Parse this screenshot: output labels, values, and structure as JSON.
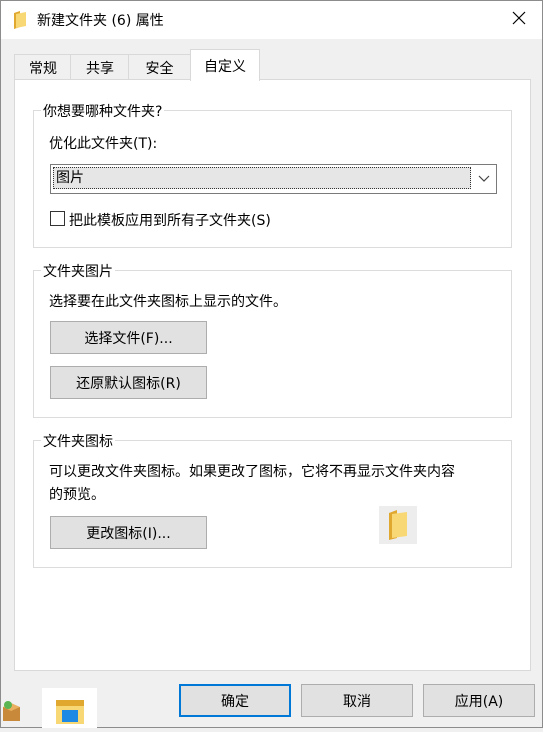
{
  "window": {
    "title": "新建文件夹 (6) 属性"
  },
  "tabs": [
    {
      "label": "常规"
    },
    {
      "label": "共享"
    },
    {
      "label": "安全"
    },
    {
      "label": "自定义"
    }
  ],
  "optimize_group": {
    "title": "你想要哪种文件夹?",
    "optimize_label": "优化此文件夹(T):",
    "optimize_value": "图片",
    "apply_subfolders_label": "把此模板应用到所有子文件夹(S)",
    "apply_subfolders_checked": false
  },
  "folder_picture_group": {
    "title": "文件夹图片",
    "description": "选择要在此文件夹图标上显示的文件。",
    "choose_file_label": "选择文件(F)...",
    "restore_default_label": "还原默认图标(R)"
  },
  "folder_icon_group": {
    "title": "文件夹图标",
    "description_line1": "可以更改文件夹图标。如果更改了图标，它将不再显示文件夹内容",
    "description_line2": "的预览。",
    "change_icon_label": "更改图标(I)..."
  },
  "footer": {
    "ok_label": "确定",
    "cancel_label": "取消",
    "apply_label": "应用(A)"
  },
  "colors": {
    "accent": "#0078d7",
    "folder_yellow": "#f8d775",
    "folder_dark": "#e0a82e"
  }
}
